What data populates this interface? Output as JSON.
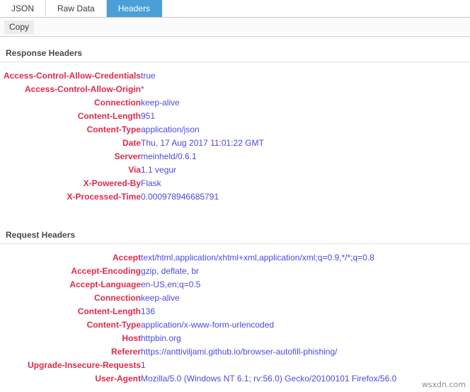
{
  "tabs": [
    {
      "label": "JSON",
      "active": false
    },
    {
      "label": "Raw Data",
      "active": false
    },
    {
      "label": "Headers",
      "active": true
    }
  ],
  "toolbar": {
    "copy_label": "Copy"
  },
  "colors": {
    "active_tab_bg": "#4a9fd8",
    "header_name": "#e02a4a",
    "header_value": "#4a4ae0",
    "section_title": "#4a4a4a"
  },
  "sections": [
    {
      "title": "Response Headers",
      "rows": [
        {
          "name": "Access-Control-Allow-Credentials",
          "value": "true"
        },
        {
          "name": "Access-Control-Allow-Origin",
          "value": "*"
        },
        {
          "name": "Connection",
          "value": "keep-alive"
        },
        {
          "name": "Content-Length",
          "value": "951"
        },
        {
          "name": "Content-Type",
          "value": "application/json"
        },
        {
          "name": "Date",
          "value": "Thu, 17 Aug 2017 11:01:22 GMT"
        },
        {
          "name": "Server",
          "value": "meinheld/0.6.1"
        },
        {
          "name": "Via",
          "value": "1.1 vegur"
        },
        {
          "name": "X-Powered-By",
          "value": "Flask"
        },
        {
          "name": "X-Processed-Time",
          "value": "0.000978946685791"
        }
      ]
    },
    {
      "title": "Request Headers",
      "rows": [
        {
          "name": "Accept",
          "value": "text/html,application/xhtml+xml,application/xml;q=0.9,*/*;q=0.8"
        },
        {
          "name": "Accept-Encoding",
          "value": "gzip, deflate, br"
        },
        {
          "name": "Accept-Language",
          "value": "en-US,en;q=0.5"
        },
        {
          "name": "Connection",
          "value": "keep-alive"
        },
        {
          "name": "Content-Length",
          "value": "136"
        },
        {
          "name": "Content-Type",
          "value": "application/x-www-form-urlencoded"
        },
        {
          "name": "Host",
          "value": "httpbin.org"
        },
        {
          "name": "Referer",
          "value": "https://anttiviljami.github.io/browser-autofill-phishing/"
        },
        {
          "name": "Upgrade-Insecure-Requests",
          "value": "1"
        },
        {
          "name": "User-Agent",
          "value": "Mozilla/5.0 (Windows NT 6.1; rv:56.0) Gecko/20100101 Firefox/56.0"
        }
      ]
    }
  ],
  "watermark": {
    "text": "wsxdn.com"
  }
}
